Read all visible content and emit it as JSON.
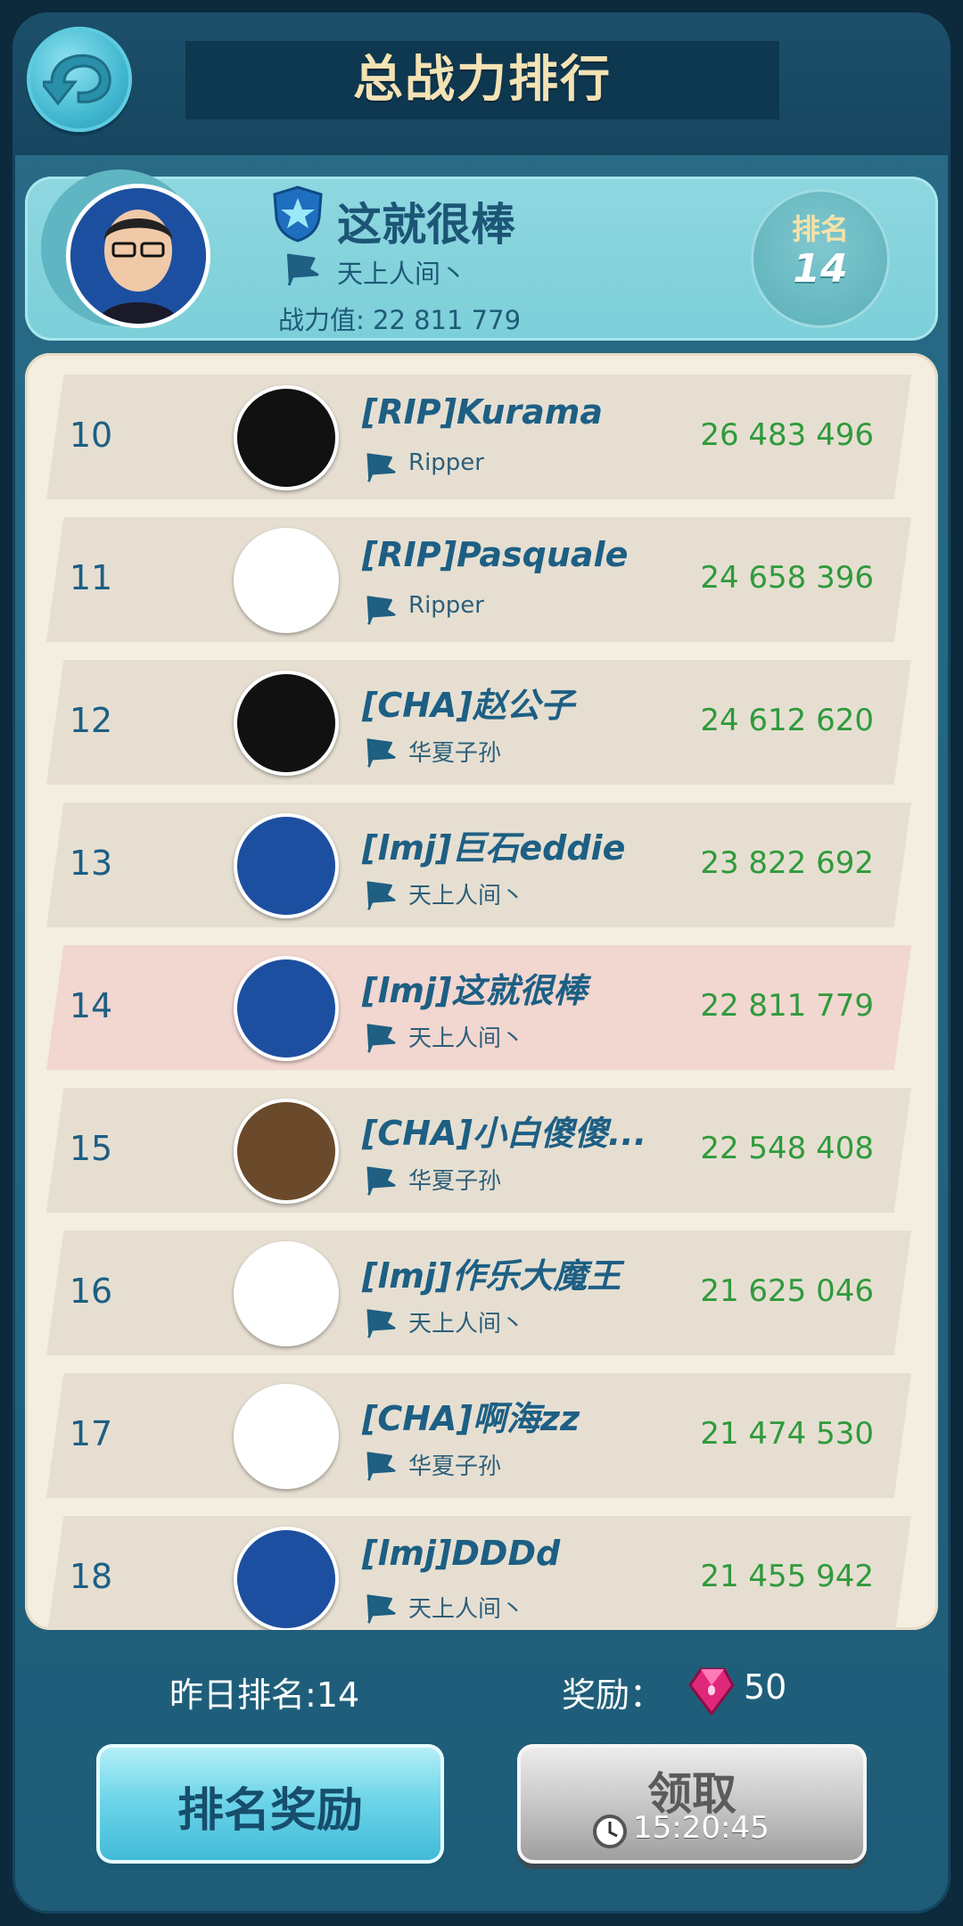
{
  "header": {
    "title": "总战力排行"
  },
  "me": {
    "name": "这就很棒",
    "guild": "天上人间丶",
    "power_text": "战力值: 22 811 779",
    "rank_label": "排名",
    "rank": "14"
  },
  "rows": [
    {
      "rank": "10",
      "name": "[RIP]Kurama",
      "guild": "Ripper",
      "power": "26 483 496"
    },
    {
      "rank": "11",
      "name": "[RIP]Pasquale",
      "guild": "Ripper",
      "power": "24 658 396"
    },
    {
      "rank": "12",
      "name": "[CHA]赵公子",
      "guild": "华夏子孙",
      "power": "24 612 620"
    },
    {
      "rank": "13",
      "name": "[lmj]巨石eddie",
      "guild": "天上人间丶",
      "power": "23 822 692"
    },
    {
      "rank": "14",
      "name": "[lmj]这就很棒",
      "guild": "天上人间丶",
      "power": "22 811 779"
    },
    {
      "rank": "15",
      "name": "[CHA]小白傻傻...",
      "guild": "华夏子孙",
      "power": "22 548 408"
    },
    {
      "rank": "16",
      "name": "[lmj]作乐大魔王",
      "guild": "天上人间丶",
      "power": "21 625 046"
    },
    {
      "rank": "17",
      "name": "[CHA]啊海zz",
      "guild": "华夏子孙",
      "power": "21 474 530"
    },
    {
      "rank": "18",
      "name": "[lmj]DDDd",
      "guild": "天上人间丶",
      "power": "21 455 942"
    }
  ],
  "footer": {
    "yesterday_rank": "昨日排名:14",
    "reward_label": "奖励：",
    "reward_amount": "50",
    "rank_reward_button": "排名奖励",
    "claim_button": "领取",
    "timer": "15:20:45"
  },
  "colors": {
    "power_green": "#2f9a3c",
    "name_blue": "#1d5f84",
    "highlight_row": "#f2d6d0"
  }
}
